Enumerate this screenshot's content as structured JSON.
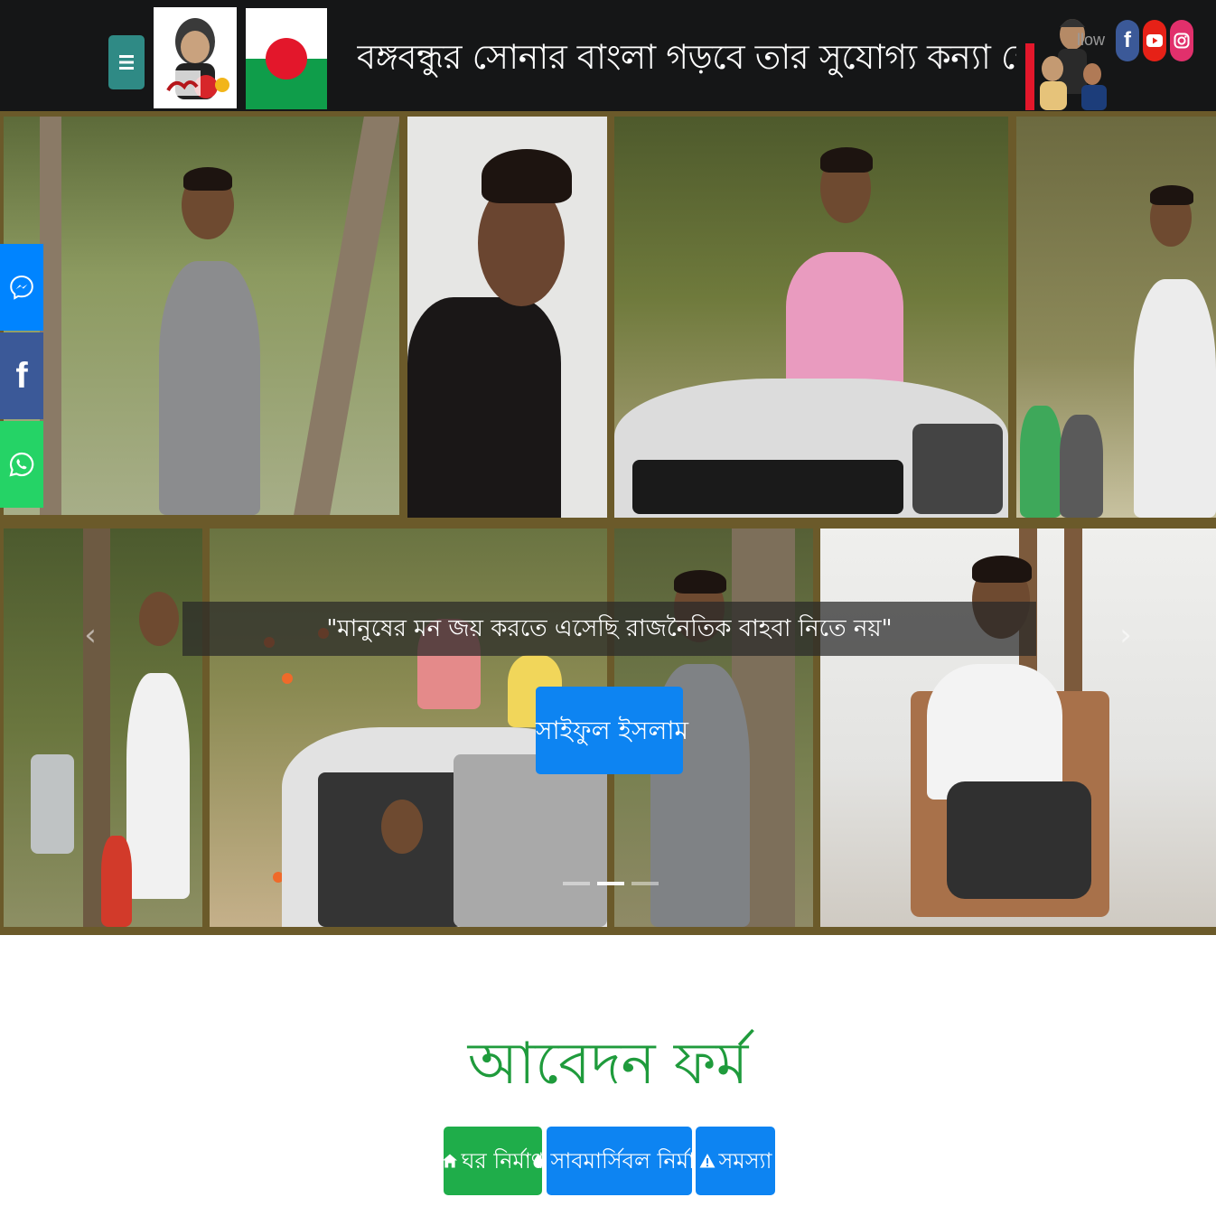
{
  "header": {
    "slogan": "বঙ্গবন্ধুর সোনার বাংলা গড়বে তার সুযোগ্য কন্যা শেখ হাসিনা",
    "follow_text": "llow",
    "menu_icon": "menu-icon",
    "colors": {
      "background": "#151617",
      "menu_button": "#2f8a85",
      "flag_green": "#0f9d4a",
      "flag_red": "#e3172b"
    }
  },
  "social_top": [
    {
      "name": "facebook",
      "icon": "facebook-icon",
      "color": "#3b5998"
    },
    {
      "name": "youtube",
      "icon": "youtube-icon",
      "color": "#e62117"
    },
    {
      "name": "instagram",
      "icon": "instagram-icon",
      "color": "#e1306c"
    }
  ],
  "side_share": [
    {
      "name": "messenger",
      "icon": "messenger-icon",
      "color": "#0084ff"
    },
    {
      "name": "facebook",
      "icon": "facebook-icon",
      "color": "#3b5998"
    },
    {
      "name": "whatsapp",
      "icon": "whatsapp-icon",
      "color": "#25d366"
    }
  ],
  "hero": {
    "quote": "\"মানুষের মন জয় করতে এসেছি রাজনৈতিক বাহবা নিতে নয়\"",
    "name_button": "সাইফুল ইসলাম",
    "prev_arrow": "‹",
    "next_arrow": "›",
    "slide_count": 3,
    "active_slide": 2
  },
  "form": {
    "title": "আবেদন ফর্ম",
    "tabs": [
      {
        "label": "ঘর নির্মাণ",
        "icon": "home-icon",
        "color": "#1fad4a"
      },
      {
        "label": "সাবমার্সিবল নির্মাণ",
        "icon": "water-drop-icon",
        "color": "#0d84f2"
      },
      {
        "label": "সমস্যা",
        "icon": "warning-icon",
        "color": "#0d84f2"
      }
    ]
  }
}
